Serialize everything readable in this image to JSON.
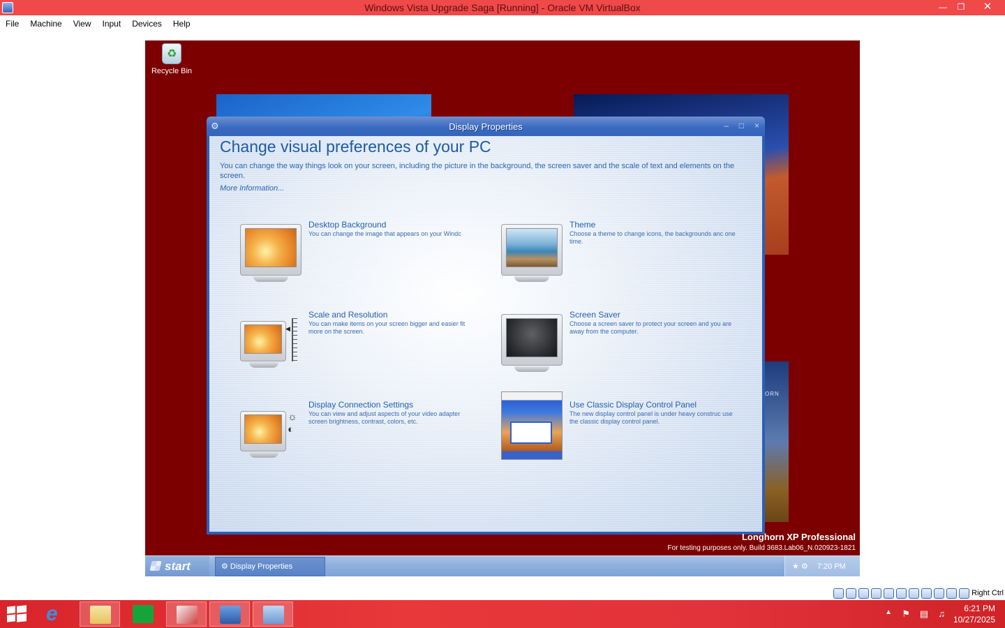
{
  "host": {
    "title": "Windows Vista Upgrade Saga [Running] - Oracle VM VirtualBox",
    "menu": [
      "File",
      "Machine",
      "View",
      "Input",
      "Devices",
      "Help"
    ],
    "status_right": "Right Ctrl",
    "taskbar": {
      "time": "6:21 PM",
      "date": "10/27/2025"
    }
  },
  "guest": {
    "desktop_icons": [
      {
        "label": "Recycle Bin",
        "icon": "recycle-bin-icon"
      }
    ],
    "window": {
      "title": "Display Properties",
      "heading": "Change visual preferences of your PC",
      "description": "You can change the way things look on your screen, including the picture in the background, the screen saver and the scale of text and elements on the screen.",
      "more_link": "More Information...",
      "options": [
        {
          "title": "Desktop Background",
          "desc": "You can change the image that appears on your Windc"
        },
        {
          "title": "Theme",
          "desc": "Choose a theme to change icons, the backgrounds anc one time."
        },
        {
          "title": "Scale and Resolution",
          "desc": "You can make items on your screen bigger and easier fit more on the screen."
        },
        {
          "title": "Screen Saver",
          "desc": "Choose a screen saver to protect your screen and you are away from the computer."
        },
        {
          "title": "Display Connection Settings",
          "desc": "You can view and adjust aspects of your video adapter screen brightness, contrast, colors, etc."
        },
        {
          "title": "Use Classic Display Control Panel",
          "desc": "The new display control panel is under heavy construc use the classic display control panel."
        }
      ]
    },
    "watermark": {
      "product": "Longhorn XP Professional",
      "build": "For testing purposes only. Build 3683.Lab06_N.020923-1821"
    },
    "taskbar": {
      "start_label": "start",
      "items": [
        "Display Properties"
      ],
      "clock": "7:20 PM"
    },
    "bg_tile_text": "ORN"
  },
  "colors": {
    "host_accent": "#f0494a",
    "guest_desktop": "#7d0000",
    "window_frame": "#2b5fb6",
    "link_blue": "#1d5aa8",
    "win8_taskbar": "#e2333a"
  }
}
